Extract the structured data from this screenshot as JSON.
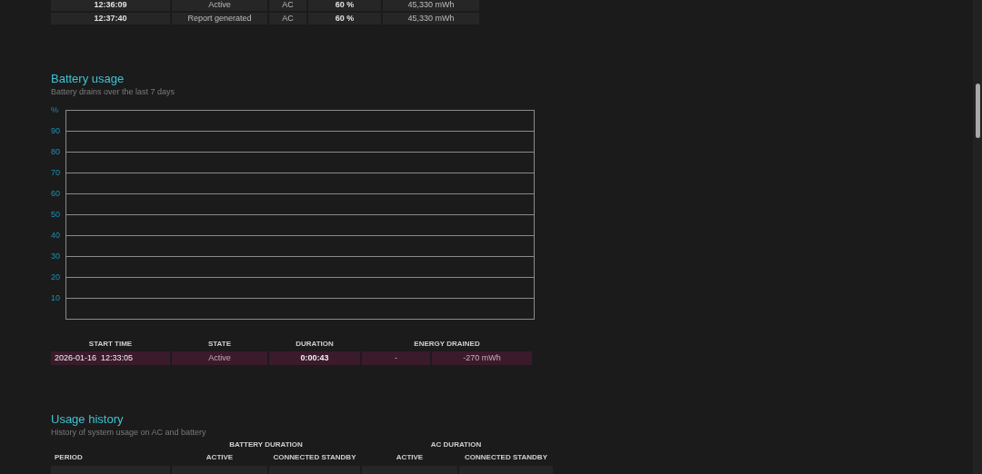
{
  "events_table": {
    "rows": [
      {
        "cells": [
          "12:36:09",
          "Active",
          "AC",
          "60 %",
          "45,330 mWh"
        ]
      },
      {
        "cells": [
          "12:37:40",
          "Report generated",
          "AC",
          "60 %",
          "45,330 mWh"
        ]
      }
    ]
  },
  "battery_usage": {
    "title": "Battery usage",
    "subtitle": "Battery drains over the last 7 days",
    "chart": {
      "unit": "%",
      "y_labels": [
        "90",
        "80",
        "70",
        "60",
        "50",
        "40",
        "30",
        "20",
        "10"
      ]
    },
    "table": {
      "columns": [
        "START TIME",
        "STATE",
        "DURATION",
        "ENERGY DRAINED"
      ],
      "rows": [
        {
          "cells": [
            "2026-01-16  12:33:05",
            "Active",
            "0:00:43",
            "-",
            "-270 mWh"
          ]
        }
      ]
    }
  },
  "usage_history": {
    "title": "Usage history",
    "subtitle": "History of system usage on AC and battery",
    "column_groups": [
      "BATTERY DURATION",
      "AC DURATION"
    ],
    "columns": [
      "PERIOD",
      "ACTIVE",
      "CONNECTED STANDBY",
      "ACTIVE",
      "CONNECTED STANDBY"
    ]
  }
}
